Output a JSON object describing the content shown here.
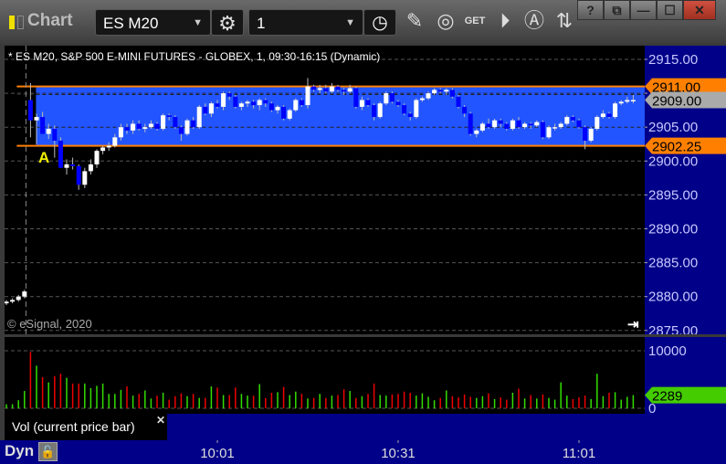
{
  "window": {
    "title": "Chart",
    "symbol": "ES M20",
    "interval": "1",
    "buttons": {
      "help": "?",
      "minimize": "—",
      "maximize": "☐",
      "close": "✕"
    }
  },
  "toolbar": {
    "icons": [
      "settings-icon",
      "clock-icon",
      "pencil-icon",
      "study-icon",
      "get-icon",
      "play-icon",
      "alert-icon",
      "link-icon"
    ],
    "get_label": "GET"
  },
  "chart": {
    "header": "* ES M20, S&P 500 E-MINI FUTURES - GLOBEX, 1, 09:30-16:15 (Dynamic)",
    "copyright": "© eSignal, 2020",
    "marker_label": "A",
    "colors": {
      "band": "#2255ff",
      "band_line": "#ff8000",
      "up": "#ffffff",
      "down": "#0000ff",
      "vol_up": "#33dd00",
      "vol_down": "#ee0000",
      "axis_bg": "#000088"
    }
  },
  "chart_data": {
    "type": "candlestick",
    "price_axis": {
      "ylim": [
        2875,
        2917
      ],
      "ticks": [
        "2915.00",
        "2910.00",
        "2905.00",
        "2900.00",
        "2895.00",
        "2890.00",
        "2885.00",
        "2880.00",
        "2875.00"
      ]
    },
    "levels": [
      {
        "label": "2911.00",
        "value": 2911.0
      },
      {
        "label": "2902.25",
        "value": 2902.25
      }
    ],
    "last_price": {
      "label": "2909.00",
      "value": 2909.0
    },
    "session_start_index": 4,
    "ohlc": [
      [
        2879,
        2879.5,
        2878.75,
        2879.25
      ],
      [
        2879.25,
        2879.75,
        2879,
        2879.5
      ],
      [
        2879.5,
        2880.25,
        2879.25,
        2880
      ],
      [
        2880,
        2881,
        2879.75,
        2880.75
      ],
      [
        2909,
        2911.5,
        2903.5,
        2906
      ],
      [
        2906,
        2907,
        2902.5,
        2906.5
      ],
      [
        2906.5,
        2907.25,
        2904,
        2904
      ],
      [
        2904,
        2905.5,
        2903.25,
        2904.75
      ],
      [
        2904.75,
        2905.25,
        2900.5,
        2903
      ],
      [
        2903,
        2903.5,
        2899,
        2899
      ],
      [
        2899,
        2900.25,
        2898,
        2899.5
      ],
      [
        2899.5,
        2900.5,
        2898.75,
        2899.25
      ],
      [
        2899.25,
        2899.5,
        2895.75,
        2896.5
      ],
      [
        2896.5,
        2899,
        2896,
        2898.5
      ],
      [
        2898.5,
        2900.25,
        2898,
        2899.5
      ],
      [
        2899.5,
        2901.75,
        2899,
        2901.5
      ],
      [
        2901.5,
        2902.25,
        2901,
        2902
      ],
      [
        2902,
        2902.75,
        2901.5,
        2902.25
      ],
      [
        2902.25,
        2904,
        2902,
        2903.5
      ],
      [
        2903.5,
        2905.5,
        2903,
        2905
      ],
      [
        2905,
        2905.5,
        2904,
        2904.5
      ],
      [
        2904.5,
        2906,
        2904,
        2905.5
      ],
      [
        2905.5,
        2906,
        2904.5,
        2904.75
      ],
      [
        2904.75,
        2905.5,
        2904.25,
        2905
      ],
      [
        2905,
        2906,
        2904.75,
        2905.5
      ],
      [
        2905.5,
        2905.75,
        2904.5,
        2904.75
      ],
      [
        2904.75,
        2907,
        2904.5,
        2906.75
      ],
      [
        2906.75,
        2907,
        2906,
        2906.5
      ],
      [
        2906.5,
        2906.75,
        2904.75,
        2905
      ],
      [
        2905,
        2905.25,
        2903,
        2904
      ],
      [
        2904,
        2906.25,
        2903.75,
        2906
      ],
      [
        2906,
        2906.5,
        2904.75,
        2905
      ],
      [
        2905,
        2908.25,
        2904.75,
        2908
      ],
      [
        2908,
        2908.5,
        2906.75,
        2907
      ],
      [
        2907,
        2908.75,
        2906.5,
        2908.5
      ],
      [
        2908.5,
        2909,
        2907.75,
        2908
      ],
      [
        2908,
        2910.25,
        2907.5,
        2910
      ],
      [
        2910,
        2910.25,
        2909,
        2909.5
      ],
      [
        2909.5,
        2909.75,
        2907.75,
        2908
      ],
      [
        2908,
        2908.75,
        2907.5,
        2908.5
      ],
      [
        2908.5,
        2909,
        2908,
        2908.75
      ],
      [
        2908.75,
        2909,
        2907.75,
        2908.25
      ],
      [
        2908.25,
        2909.25,
        2907.5,
        2909
      ],
      [
        2909,
        2909.25,
        2908,
        2908.5
      ],
      [
        2908.5,
        2908.75,
        2907.25,
        2907.5
      ],
      [
        2907.5,
        2908.25,
        2907,
        2908
      ],
      [
        2908,
        2908.25,
        2906,
        2906.25
      ],
      [
        2906.25,
        2907.75,
        2906,
        2907.5
      ],
      [
        2907.5,
        2909.25,
        2907.25,
        2909
      ],
      [
        2909,
        2909.25,
        2908,
        2908.25
      ],
      [
        2908.25,
        2912.25,
        2907.75,
        2911
      ],
      [
        2911,
        2911.25,
        2910.25,
        2910.5
      ],
      [
        2910.5,
        2911.25,
        2910,
        2910.75
      ],
      [
        2910.75,
        2911.25,
        2910,
        2910.25
      ],
      [
        2910.25,
        2911.5,
        2910,
        2911
      ],
      [
        2911,
        2911.25,
        2910.25,
        2910.5
      ],
      [
        2910.5,
        2910.75,
        2909.75,
        2910.25
      ],
      [
        2910.25,
        2911.25,
        2910,
        2910.75
      ],
      [
        2910.75,
        2911,
        2907.75,
        2908
      ],
      [
        2908,
        2909.5,
        2907.5,
        2909
      ],
      [
        2909,
        2909.25,
        2908,
        2908.25
      ],
      [
        2908.25,
        2908.5,
        2906,
        2906.5
      ],
      [
        2906.5,
        2908.75,
        2906.25,
        2908.5
      ],
      [
        2908.5,
        2910.25,
        2908.25,
        2910
      ],
      [
        2910,
        2910.25,
        2908.5,
        2908.75
      ],
      [
        2908.75,
        2909,
        2908,
        2908.25
      ],
      [
        2908.25,
        2908.5,
        2906.75,
        2907
      ],
      [
        2907,
        2907.25,
        2906,
        2906.5
      ],
      [
        2906.5,
        2909.25,
        2906.25,
        2909
      ],
      [
        2909,
        2909.5,
        2908.75,
        2909.25
      ],
      [
        2909.25,
        2910.25,
        2909,
        2910
      ],
      [
        2910,
        2910.75,
        2909.75,
        2910.5
      ],
      [
        2910.5,
        2910.75,
        2910,
        2910.25
      ],
      [
        2910.25,
        2910.75,
        2909.75,
        2910.5
      ],
      [
        2910.5,
        2910.75,
        2909.25,
        2909.5
      ],
      [
        2909.5,
        2909.75,
        2907.75,
        2908
      ],
      [
        2908,
        2908.25,
        2906.5,
        2907
      ],
      [
        2907,
        2907.25,
        2903.75,
        2904
      ],
      [
        2904,
        2904.75,
        2903.5,
        2904.5
      ],
      [
        2904.5,
        2905.75,
        2904.25,
        2905.5
      ],
      [
        2905.5,
        2906.25,
        2904.75,
        2905
      ],
      [
        2905,
        2906.25,
        2904.75,
        2906
      ],
      [
        2906,
        2906.25,
        2905,
        2905.5
      ],
      [
        2905.5,
        2905.75,
        2904.5,
        2904.75
      ],
      [
        2904.75,
        2906.25,
        2904.5,
        2906
      ],
      [
        2906,
        2906.5,
        2904.75,
        2905
      ],
      [
        2905,
        2905.75,
        2904.75,
        2905.5
      ],
      [
        2905.5,
        2905.75,
        2904.75,
        2905.25
      ],
      [
        2905.25,
        2906,
        2905,
        2905.75
      ],
      [
        2905.75,
        2906,
        2903.25,
        2903.5
      ],
      [
        2903.5,
        2905.25,
        2903.25,
        2905
      ],
      [
        2905,
        2905.5,
        2904.5,
        2905
      ],
      [
        2905,
        2905.75,
        2904.75,
        2905.5
      ],
      [
        2905.5,
        2906.75,
        2905.25,
        2906.5
      ],
      [
        2906.5,
        2906.75,
        2905.75,
        2906
      ],
      [
        2906,
        2906.25,
        2904.75,
        2905
      ],
      [
        2905,
        2905.25,
        2901.75,
        2903
      ],
      [
        2903,
        2905,
        2902.75,
        2904.75
      ],
      [
        2904.75,
        2906.75,
        2904.5,
        2906.5
      ],
      [
        2906.5,
        2907.5,
        2906.25,
        2907
      ],
      [
        2907,
        2907.25,
        2906.25,
        2906.5
      ],
      [
        2906.5,
        2908.75,
        2906.25,
        2908.5
      ],
      [
        2908.5,
        2909,
        2908.25,
        2908.75
      ],
      [
        2908.75,
        2909.5,
        2908.5,
        2909
      ],
      [
        2909,
        2909.75,
        2908.5,
        2909
      ]
    ],
    "volume": {
      "title": "Vol (current price bar)",
      "ticks": [
        "10000",
        "0"
      ],
      "ylim": [
        0,
        10000
      ],
      "last": {
        "label": "2289",
        "value": 2289
      },
      "values": [
        700,
        700,
        1400,
        3000,
        9800,
        7400,
        5400,
        4500,
        5600,
        6000,
        5300,
        4300,
        4300,
        4300,
        3500,
        3900,
        4300,
        2500,
        2500,
        3200,
        3800,
        2200,
        2500,
        3100,
        1700,
        2200,
        2700,
        1500,
        2100,
        2600,
        2100,
        2500,
        1800,
        1800,
        3800,
        3600,
        2300,
        2300,
        3600,
        2500,
        2200,
        2200,
        4200,
        1800,
        2700,
        2800,
        3700,
        2300,
        2900,
        2500,
        1700,
        1800,
        2500,
        1800,
        2200,
        2300,
        3300,
        3000,
        1800,
        2100,
        2500,
        4300,
        2300,
        2200,
        2400,
        2500,
        2900,
        2700,
        2200,
        2600,
        2000,
        1400,
        1800,
        3100,
        2100,
        1900,
        2400,
        2000,
        1800,
        2100,
        2600,
        1600,
        1900,
        1500,
        2700,
        3400,
        1700,
        2300,
        1700,
        2400,
        1800,
        1500,
        4500,
        2200,
        1600,
        1900,
        2200,
        1600,
        6000,
        2100,
        2700,
        2800,
        1500,
        2000,
        2289
      ]
    },
    "time_ticks": [
      {
        "label": "10:01",
        "index": 35
      },
      {
        "label": "10:31",
        "index": 65
      },
      {
        "label": "11:01",
        "index": 95
      }
    ]
  },
  "bottom": {
    "mode_label": "Dyn"
  }
}
